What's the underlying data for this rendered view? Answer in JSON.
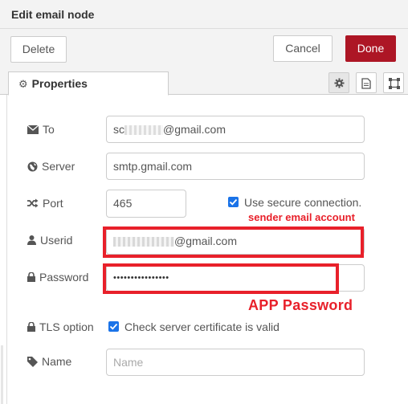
{
  "header": {
    "title": "Edit email node"
  },
  "toolbar": {
    "delete_label": "Delete",
    "cancel_label": "Cancel",
    "done_label": "Done"
  },
  "tabs": {
    "properties_label": "Properties"
  },
  "fields": {
    "to": {
      "label": "To",
      "value_suffix": "@gmail.com",
      "value_prefix": "sc"
    },
    "server": {
      "label": "Server",
      "value": "smtp.gmail.com"
    },
    "port": {
      "label": "Port",
      "value": "465"
    },
    "secure": {
      "label": "Use secure connection.",
      "checked": true
    },
    "userid": {
      "label": "Userid",
      "value_suffix": "@gmail.com"
    },
    "password": {
      "label": "Password",
      "masked": "••••••••••••••••"
    },
    "tls": {
      "label": "TLS option",
      "checkbox_label": "Check server certificate is valid",
      "checked": true
    },
    "name": {
      "label": "Name",
      "placeholder": "Name"
    }
  },
  "annotations": {
    "sender": "sender email account",
    "app_password": "APP Password"
  },
  "colors": {
    "accent": "#ad1625",
    "annotation": "#e8202a",
    "checkbox": "#1a73e8"
  }
}
